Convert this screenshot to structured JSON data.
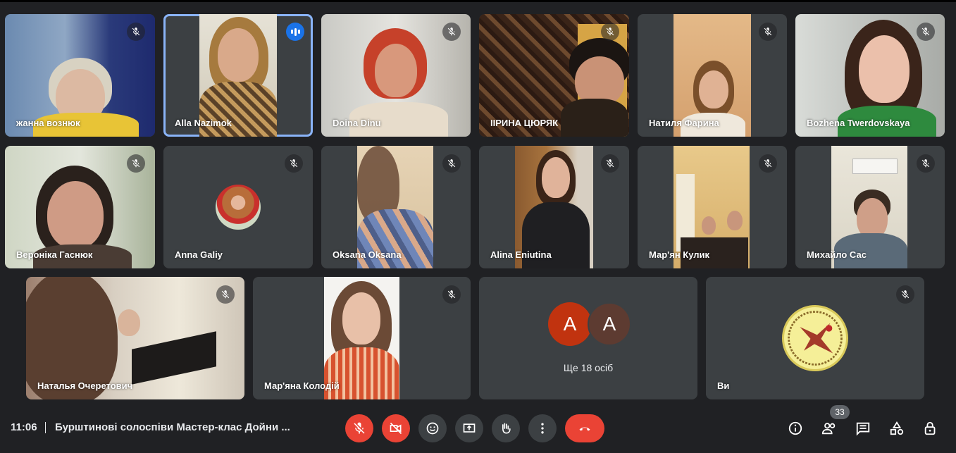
{
  "participants": [
    {
      "name": "жанна вознюк",
      "muted": true
    },
    {
      "name": "Alla Nazimok",
      "muted": false,
      "speaking": true
    },
    {
      "name": "Doina Dinu",
      "muted": true
    },
    {
      "name": "ІІРИНА ЦЮРЯК",
      "muted": true
    },
    {
      "name": "Натиля Фарина",
      "muted": true
    },
    {
      "name": "Bozhena Twerdovskaya",
      "muted": true
    },
    {
      "name": "Вероніка Гаснюк",
      "muted": true
    },
    {
      "name": "Anna Galiy",
      "muted": true
    },
    {
      "name": "Oksana Oksana",
      "muted": true
    },
    {
      "name": "Alina Eniutina",
      "muted": true
    },
    {
      "name": "Мар'ян Кулик",
      "muted": true
    },
    {
      "name": "Михайло Сас",
      "muted": true
    },
    {
      "name": "Наталья Очеретович",
      "muted": true
    },
    {
      "name": "Мар'яна Колодій",
      "muted": true
    }
  ],
  "more_tile": {
    "avatar1": "A",
    "avatar2": "A",
    "label": "Ще 18 осіб"
  },
  "self_tile": {
    "name": "Ви",
    "muted": true
  },
  "bottom_bar": {
    "time": "11:06",
    "meeting_title": "Бурштинові солоспіви Мастер-клас Дойни ...",
    "participant_count": "33",
    "controls": [
      "mic-off",
      "camera-off",
      "reactions",
      "present",
      "raise-hand",
      "more-options",
      "leave-call"
    ],
    "right_icons": [
      "info",
      "people",
      "chat",
      "activities",
      "host-controls"
    ]
  },
  "colors": {
    "background": "#202124",
    "tile": "#3c4043",
    "red": "#ea4335",
    "blue": "#1a73e8",
    "active_border": "#8ab4f8"
  }
}
